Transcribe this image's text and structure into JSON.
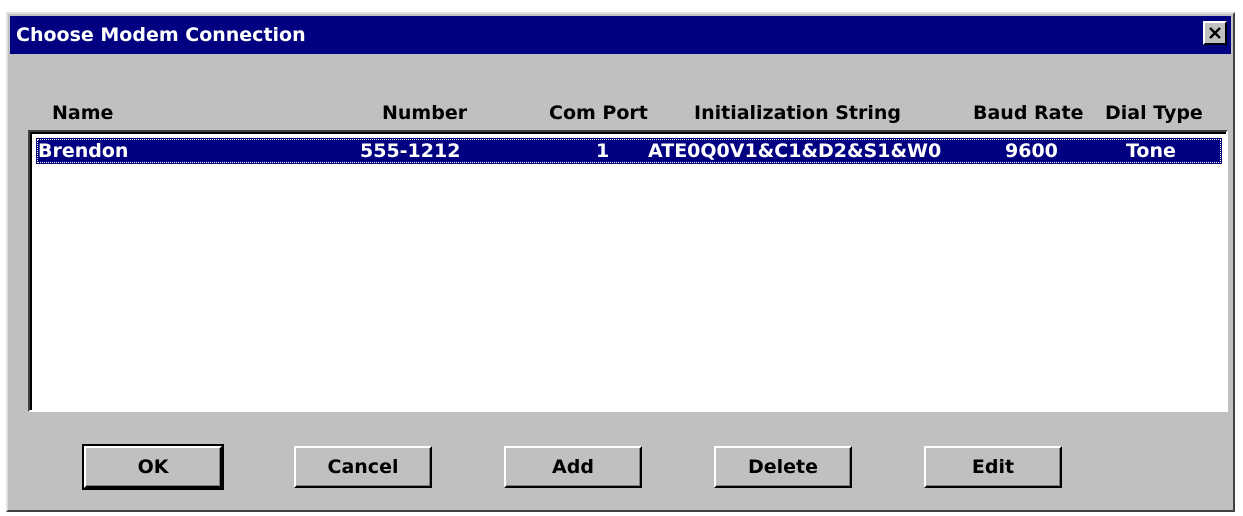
{
  "window": {
    "title": "Choose Modem Connection",
    "close_symbol": "×"
  },
  "columns": {
    "name": "Name",
    "number": "Number",
    "com_port": "Com Port",
    "init_string": "Initialization String",
    "baud_rate": "Baud Rate",
    "dial_type": "Dial Type"
  },
  "connections": [
    {
      "name": "Brendon",
      "number": "555-1212",
      "com_port": "1",
      "init_string": "ATE0Q0V1&C1&D2&S1&W0",
      "baud_rate": "9600",
      "dial_type": "Tone",
      "selected": true
    }
  ],
  "buttons": {
    "ok": "OK",
    "cancel": "Cancel",
    "add": "Add",
    "delete": "Delete",
    "edit": "Edit"
  },
  "colors": {
    "title_bar": "#000080",
    "selection": "#000080",
    "face": "#c0c0c0"
  },
  "icons": {
    "close": "close-icon"
  }
}
